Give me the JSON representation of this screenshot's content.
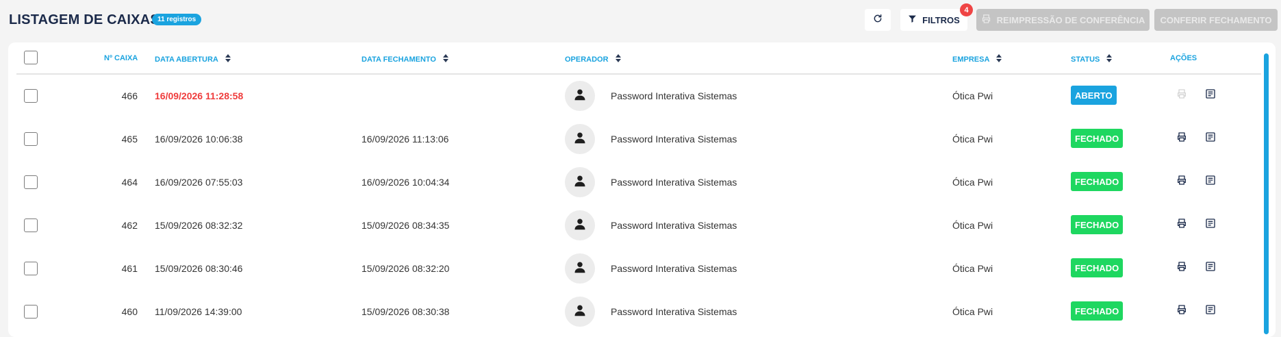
{
  "header": {
    "title": "LISTAGEM DE CAIXAS",
    "count_badge": "11 registros",
    "filters_label": "FILTROS",
    "filters_count": "4",
    "reprint_label": "REIMPRESSÃO DE CONFERÊNCIA",
    "conferir_label": "CONFERIR FECHAMENTO"
  },
  "table": {
    "columns": {
      "caixa": "Nº CAIXA",
      "abertura": "DATA ABERTURA",
      "fechamento": "DATA FECHAMENTO",
      "operador": "OPERADOR",
      "empresa": "EMPRESA",
      "status": "STATUS",
      "acoes": "AÇÕES"
    },
    "rows": [
      {
        "caixa": "466",
        "abertura": "16/09/2026 11:28:58",
        "fechamento": "",
        "operador": "Password Interativa Sistemas",
        "empresa": "Ótica Pwi",
        "status": "ABERTO",
        "print_enabled": false
      },
      {
        "caixa": "465",
        "abertura": "16/09/2026 10:06:38",
        "fechamento": "16/09/2026 11:13:06",
        "operador": "Password Interativa Sistemas",
        "empresa": "Ótica Pwi",
        "status": "FECHADO",
        "print_enabled": true
      },
      {
        "caixa": "464",
        "abertura": "16/09/2026 07:55:03",
        "fechamento": "16/09/2026 10:04:34",
        "operador": "Password Interativa Sistemas",
        "empresa": "Ótica Pwi",
        "status": "FECHADO",
        "print_enabled": true
      },
      {
        "caixa": "462",
        "abertura": "15/09/2026 08:32:32",
        "fechamento": "15/09/2026 08:34:35",
        "operador": "Password Interativa Sistemas",
        "empresa": "Ótica Pwi",
        "status": "FECHADO",
        "print_enabled": true
      },
      {
        "caixa": "461",
        "abertura": "15/09/2026 08:30:46",
        "fechamento": "15/09/2026 08:32:20",
        "operador": "Password Interativa Sistemas",
        "empresa": "Ótica Pwi",
        "status": "FECHADO",
        "print_enabled": true
      },
      {
        "caixa": "460",
        "abertura": "11/09/2026 14:39:00",
        "fechamento": "15/09/2026 08:30:38",
        "operador": "Password Interativa Sistemas",
        "empresa": "Ótica Pwi",
        "status": "FECHADO",
        "print_enabled": true
      }
    ]
  },
  "colors": {
    "accent": "#1aa3df",
    "status_aberto": "#1aa3df",
    "status_fechado": "#1ed760",
    "open_date": "#ef3b3b",
    "filter_badge": "#ef4444"
  },
  "icons": {
    "refresh": "refresh-icon",
    "filter": "filter-icon",
    "printer": "printer-icon",
    "details": "document-icon",
    "user": "user-icon",
    "sort": "sort-icon"
  }
}
